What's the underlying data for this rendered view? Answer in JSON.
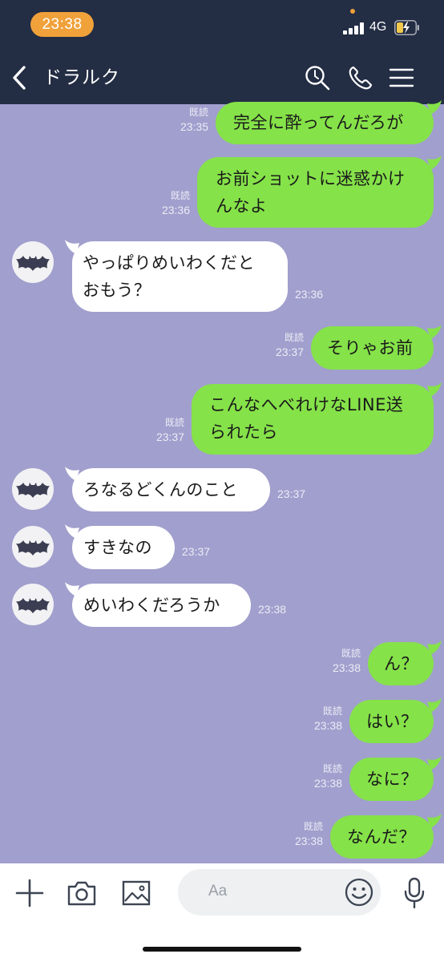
{
  "status_bar": {
    "time": "23:38",
    "network": "4G"
  },
  "header": {
    "title": "ドラルク"
  },
  "messages": [
    {
      "dir": "out",
      "text": "完全に酔ってんだろが",
      "read": "既読",
      "time": "23:35"
    },
    {
      "dir": "out",
      "text": "お前ショットに迷惑かけ\nんなよ",
      "read": "既読",
      "time": "23:36"
    },
    {
      "dir": "in",
      "text": "やっぱりめいわくだと\nおもう？",
      "time": "23:36"
    },
    {
      "dir": "out",
      "text": "そりゃお前",
      "read": "既読",
      "time": "23:37"
    },
    {
      "dir": "out",
      "text": "こんなへべれけなLINE送\nられたら",
      "read": "既読",
      "time": "23:37"
    },
    {
      "dir": "in",
      "text": "ろなるどくんのこと",
      "time": "23:37"
    },
    {
      "dir": "in",
      "text": "すきなの",
      "time": "23:37"
    },
    {
      "dir": "in",
      "text": "めいわくだろうか",
      "time": "23:38"
    },
    {
      "dir": "out",
      "text": "ん？",
      "read": "既読",
      "time": "23:38"
    },
    {
      "dir": "out",
      "text": "はい？",
      "read": "既読",
      "time": "23:38"
    },
    {
      "dir": "out",
      "text": "なに？",
      "read": "既読",
      "time": "23:38"
    },
    {
      "dir": "out",
      "text": "なんだ？",
      "read": "既読",
      "time": "23:38"
    }
  ],
  "composer": {
    "placeholder": "Aa"
  },
  "colors": {
    "header": "#232d44",
    "background": "#a19fcd",
    "outgoing": "#85e249",
    "incoming": "#ffffff",
    "time_pill": "#f0a13a"
  },
  "icons": [
    "back-icon",
    "search-icon",
    "phone-icon",
    "menu-icon",
    "plus-icon",
    "camera-icon",
    "image-icon",
    "emoji-icon",
    "mic-icon",
    "bat-avatar-icon"
  ]
}
